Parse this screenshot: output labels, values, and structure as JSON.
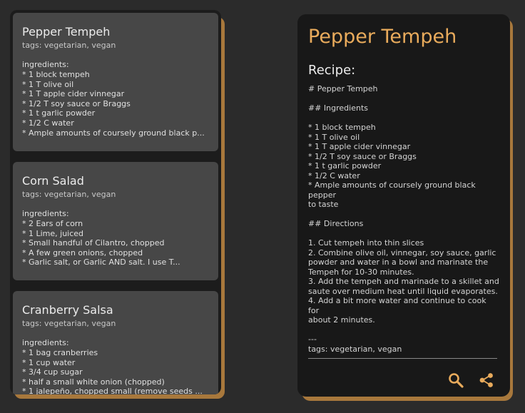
{
  "cards": [
    {
      "title": "Pepper Tempeh",
      "tags": "tags: vegetarian, vegan",
      "ingredients_label": "ingredients:",
      "lines": [
        "* 1 block tempeh",
        "* 1 T olive oil",
        "* 1 T apple cider vinnegar",
        "* 1/2 T soy sauce or Braggs",
        "* 1 t garlic powder",
        "* 1/2 C water",
        "* Ample amounts of coursely ground black p..."
      ]
    },
    {
      "title": "Corn Salad",
      "tags": "tags: vegetarian, vegan",
      "ingredients_label": "ingredients:",
      "lines": [
        "* 2 Ears of corn",
        "* 1 Lime, juiced",
        "* Small handful of Cilantro, chopped",
        "* A few green onions, chopped",
        "* Garlic salt, or Garlic AND salt. I use T..."
      ]
    },
    {
      "title": "Cranberry Salsa",
      "tags": "tags: vegetarian, vegan",
      "ingredients_label": "ingredients:",
      "lines": [
        "* 1 bag cranberries",
        "* 1 cup water",
        "* 3/4 cup sugar",
        "* half a small white onion (chopped)",
        "* 1 jalepeño, chopped small (remove seeds ..."
      ]
    }
  ],
  "detail": {
    "title": "Pepper Tempeh",
    "recipe_label": "Recipe:",
    "recipe_text": "# Pepper Tempeh\n\n## Ingredients\n\n* 1 block tempeh\n* 1 T olive oil\n* 1 T apple cider vinnegar\n* 1/2 T soy sauce or Braggs\n* 1 t garlic powder\n* 1/2 C water\n* Ample amounts of coursely ground black pepper\nto taste\n\n## Directions\n\n1. Cut tempeh into thin slices\n2. Combine olive oil, vinnegar, soy sauce, garlic\npowder and water in a bowl and marinate the\nTempeh for 10-30 minutes.\n3. Add the tempeh and marinade to a skillet and\nsaute over medium heat until liquid evaporates.\n4. Add a bit more water and continue to cook for\nabout 2 minutes.\n\n---\ntags: vegetarian, vegan",
    "actions": {
      "search_icon": "search-icon",
      "share_icon": "share-icon"
    }
  },
  "colors": {
    "accent": "#e9ab5c",
    "shadow": "#a8783c",
    "panel": "#181818",
    "card": "#474747",
    "background": "#2b2b2b"
  }
}
